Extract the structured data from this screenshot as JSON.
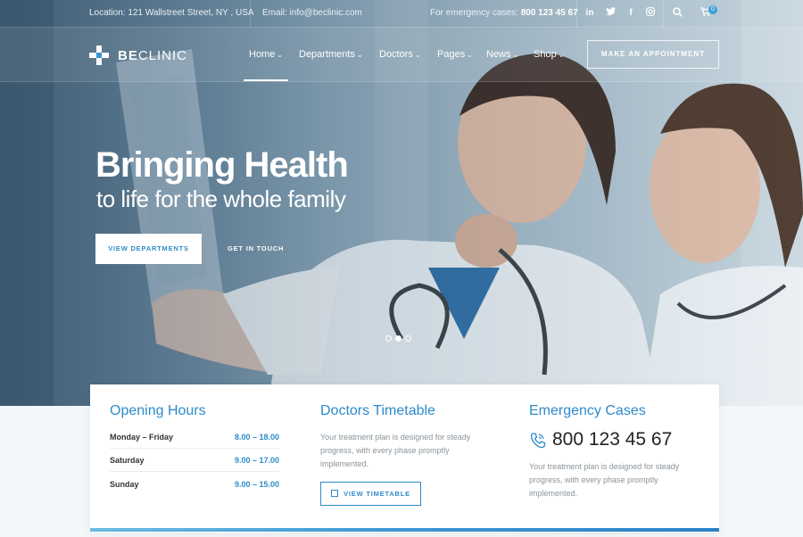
{
  "topbar": {
    "location": "Location: 121 Wallstreet Street, NY , USA",
    "email": "Email: info@beclinic.com",
    "emergency_label": "For emergency cases:",
    "emergency_phone": "800 123 45 67",
    "social_icons": [
      "linkedin-icon",
      "twitter-icon",
      "facebook-icon",
      "instagram-icon"
    ],
    "cart_count": "0"
  },
  "logo": {
    "bold": "BE",
    "rest": "CLINIC"
  },
  "nav": {
    "items": [
      {
        "label": "Home",
        "active": true
      },
      {
        "label": "Departments"
      },
      {
        "label": "Doctors"
      },
      {
        "label": "Pages"
      },
      {
        "label": "News"
      },
      {
        "label": "Shop"
      }
    ],
    "cta": "MAKE AN APPOINTMENT"
  },
  "hero": {
    "title": "Bringing Health",
    "subtitle": "to life for the whole family",
    "primary_button": "VIEW DEPARTMENTS",
    "secondary_button": "GET IN TOUCH",
    "slides": 3,
    "active_slide": 2
  },
  "opening_hours": {
    "title": "Opening Hours",
    "rows": [
      {
        "day": "Monday – Friday",
        "time": "8.00 – 18.00"
      },
      {
        "day": "Saturday",
        "time": "9.00 – 17.00"
      },
      {
        "day": "Sunday",
        "time": "9.00 – 15.00"
      }
    ]
  },
  "timetable": {
    "title": "Doctors Timetable",
    "text": "Your treatment plan is designed for steady progress, with every phase promptly implemented.",
    "button": "VIEW TIMETABLE"
  },
  "emergency": {
    "title": "Emergency Cases",
    "phone": "800 123 45 67",
    "text": "Your treatment plan is designed for steady progress, with every phase promptly implemented."
  },
  "colors": {
    "accent": "#2e8bc9",
    "white": "#ffffff"
  }
}
